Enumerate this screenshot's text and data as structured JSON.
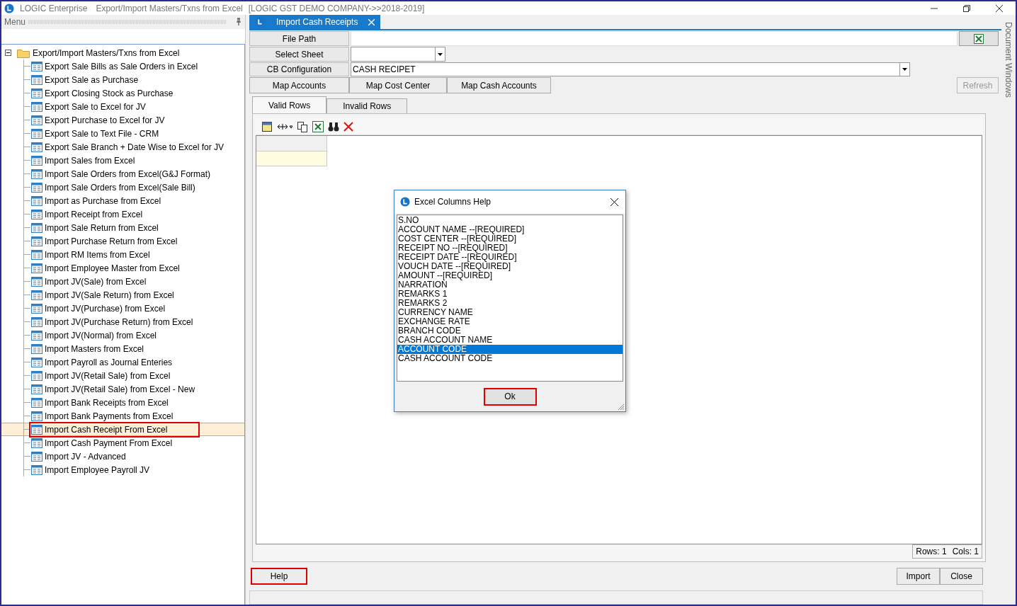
{
  "window": {
    "app_name": "LOGIC Enterprise",
    "title": "Export/Import Masters/Txns from Excel",
    "company": "[LOGIC GST DEMO COMPANY->>2018-2019]"
  },
  "menu_panel": {
    "title": "Menu",
    "tree": {
      "label": "Export/Import Masters/Txns from Excel",
      "expanded": true,
      "children": [
        {
          "label": "Export Sale Bills as Sale Orders in Excel",
          "selected": false,
          "highlighted": false
        },
        {
          "label": "Export Sale as Purchase",
          "selected": false,
          "highlighted": false
        },
        {
          "label": "Export Closing Stock as Purchase",
          "selected": false,
          "highlighted": false
        },
        {
          "label": "Export Sale to Excel for JV",
          "selected": false,
          "highlighted": false
        },
        {
          "label": "Export Purchase to Excel for JV",
          "selected": false,
          "highlighted": false
        },
        {
          "label": "Export Sale to Text File - CRM",
          "selected": false,
          "highlighted": false
        },
        {
          "label": "Export Sale Branch + Date Wise to Excel for JV",
          "selected": false,
          "highlighted": false
        },
        {
          "label": "Import Sales from Excel",
          "selected": false,
          "highlighted": false
        },
        {
          "label": "Import Sale Orders from Excel(G&J Format)",
          "selected": false,
          "highlighted": false
        },
        {
          "label": "Import Sale Orders from Excel(Sale Bill)",
          "selected": false,
          "highlighted": false
        },
        {
          "label": "Import as Purchase from Excel",
          "selected": false,
          "highlighted": false
        },
        {
          "label": "Import Receipt from Excel",
          "selected": false,
          "highlighted": false
        },
        {
          "label": "Import Sale Return from Excel",
          "selected": false,
          "highlighted": false
        },
        {
          "label": "Import Purchase Return from Excel",
          "selected": false,
          "highlighted": false
        },
        {
          "label": "Import RM Items from Excel",
          "selected": false,
          "highlighted": false
        },
        {
          "label": "Import Employee Master from Excel",
          "selected": false,
          "highlighted": false
        },
        {
          "label": "Import JV(Sale) from Excel",
          "selected": false,
          "highlighted": false
        },
        {
          "label": "Import JV(Sale Return) from Excel",
          "selected": false,
          "highlighted": false
        },
        {
          "label": "Import JV(Purchase) from Excel",
          "selected": false,
          "highlighted": false
        },
        {
          "label": "Import JV(Purchase Return) from Excel",
          "selected": false,
          "highlighted": false
        },
        {
          "label": "Import JV(Normal) from Excel",
          "selected": false,
          "highlighted": false
        },
        {
          "label": "Import Masters from Excel",
          "selected": false,
          "highlighted": false
        },
        {
          "label": "Import Payroll as Journal Enteries",
          "selected": false,
          "highlighted": false
        },
        {
          "label": "Import JV(Retail Sale) from Excel",
          "selected": false,
          "highlighted": false
        },
        {
          "label": "Import JV(Retail Sale) from Excel - New",
          "selected": false,
          "highlighted": false
        },
        {
          "label": "Import Bank Receipts from Excel",
          "selected": false,
          "highlighted": false
        },
        {
          "label": "Import Bank Payments from Excel",
          "selected": false,
          "highlighted": false
        },
        {
          "label": "Import Cash Receipt From Excel",
          "selected": true,
          "highlighted": true
        },
        {
          "label": "Import Cash Payment From Excel",
          "selected": false,
          "highlighted": false
        },
        {
          "label": "Import JV - Advanced",
          "selected": false,
          "highlighted": false
        },
        {
          "label": "Import Employee Payroll JV",
          "selected": false,
          "highlighted": false
        }
      ]
    }
  },
  "document_tab": {
    "label": "Import Cash Receipts"
  },
  "form": {
    "file_path": {
      "label": "File Path"
    },
    "select_sheet": {
      "label": "Select Sheet"
    },
    "cb_configuration": {
      "label": "CB Configuration",
      "value": "CASH RECIPET"
    }
  },
  "map_buttons": [
    "Map Accounts",
    "Map Cost Center",
    "Map Cash Accounts"
  ],
  "refresh_button": {
    "label": "Refresh",
    "disabled": true
  },
  "grid_tabs": [
    {
      "label": "Valid Rows",
      "selected": true
    },
    {
      "label": "Invalid Rows",
      "selected": false
    }
  ],
  "grid_status": {
    "rows": "Rows: 1",
    "cols": "Cols: 1"
  },
  "help_button": {
    "label": "Help",
    "highlighted": true
  },
  "action_buttons": [
    "Import",
    "Close"
  ],
  "side_strip": {
    "label": "Document Windows"
  },
  "dialog": {
    "title": "Excel Columns Help",
    "items": [
      {
        "label": "S.NO",
        "selected": false
      },
      {
        "label": "ACCOUNT NAME --[REQUIRED]",
        "selected": false
      },
      {
        "label": "COST CENTER --[REQUIRED]",
        "selected": false
      },
      {
        "label": "RECEIPT NO --[REQUIRED]",
        "selected": false
      },
      {
        "label": "RECEIPT DATE --[REQUIRED]",
        "selected": false
      },
      {
        "label": "VOUCH DATE --[REQUIRED]",
        "selected": false
      },
      {
        "label": "AMOUNT --[REQUIRED]",
        "selected": false
      },
      {
        "label": "NARRATION",
        "selected": false
      },
      {
        "label": "REMARKS 1",
        "selected": false
      },
      {
        "label": "REMARKS 2",
        "selected": false
      },
      {
        "label": "CURRENCY NAME",
        "selected": false
      },
      {
        "label": "EXCHANGE RATE",
        "selected": false
      },
      {
        "label": "BRANCH CODE",
        "selected": false
      },
      {
        "label": "CASH ACCOUNT NAME",
        "selected": false
      },
      {
        "label": "ACCOUNT CODE",
        "selected": true
      },
      {
        "label": "CASH ACCOUNT CODE",
        "selected": false
      }
    ],
    "ok_button": {
      "label": "Ok",
      "highlighted": true
    }
  }
}
